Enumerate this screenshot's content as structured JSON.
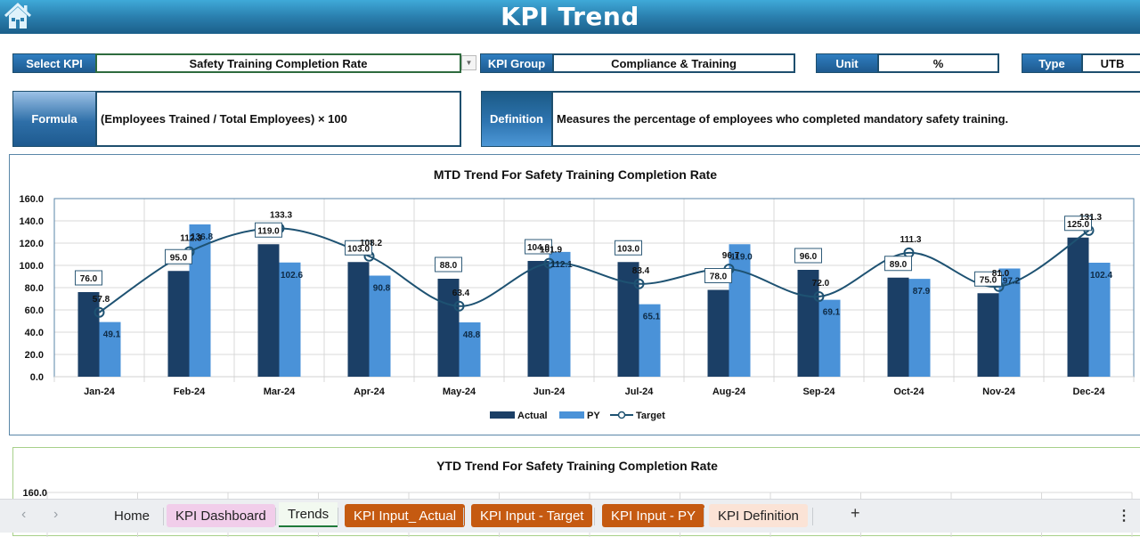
{
  "header": {
    "title": "KPI Trend",
    "home_icon": "home-icon"
  },
  "selectors": {
    "select_kpi_label": "Select KPI",
    "select_kpi_value": "Safety Training Completion Rate",
    "kpi_group_label": "KPI Group",
    "kpi_group_value": "Compliance & Training",
    "unit_label": "Unit",
    "unit_value": "%",
    "type_label": "Type",
    "type_value": "UTB"
  },
  "info": {
    "formula_label": "Formula",
    "formula_value": "(Employees Trained / Total Employees) × 100",
    "definition_label": "Definition",
    "definition_value": "Measures the percentage of employees who completed mandatory safety training."
  },
  "colors": {
    "actual": "#1b3f66",
    "py": "#4a92d8",
    "target": "#1e5272",
    "header": "#2a7fae"
  },
  "chart_data": [
    {
      "type": "bar",
      "title": "MTD Trend For Safety Training Completion Rate",
      "xlabel": "",
      "ylabel": "",
      "ylim": [
        0,
        160
      ],
      "yticks": [
        "0.0",
        "20.0",
        "40.0",
        "60.0",
        "80.0",
        "100.0",
        "120.0",
        "140.0",
        "160.0"
      ],
      "grid": true,
      "legend": "bottom",
      "categories": [
        "Jan-24",
        "Feb-24",
        "Mar-24",
        "Apr-24",
        "May-24",
        "Jun-24",
        "Jul-24",
        "Aug-24",
        "Sep-24",
        "Oct-24",
        "Nov-24",
        "Dec-24"
      ],
      "series": [
        {
          "name": "Actual",
          "kind": "bar",
          "values": [
            76.0,
            95.0,
            119.0,
            103.0,
            88.0,
            104.0,
            103.0,
            78.0,
            96.0,
            89.0,
            75.0,
            125.0
          ]
        },
        {
          "name": "PY",
          "kind": "bar",
          "values": [
            49.1,
            136.8,
            102.6,
            90.8,
            48.8,
            112.1,
            65.1,
            119.0,
            69.1,
            87.9,
            97.2,
            102.4
          ]
        },
        {
          "name": "Target",
          "kind": "line",
          "values": [
            57.8,
            112.3,
            133.3,
            108.2,
            63.4,
            101.9,
            83.4,
            96.7,
            72.0,
            111.3,
            81.0,
            131.3
          ]
        }
      ]
    },
    {
      "type": "bar",
      "title": "YTD Trend For Safety Training Completion Rate",
      "ylim_top_visible": "160.0"
    }
  ],
  "tabs": {
    "prev_icon": "‹",
    "next_icon": "›",
    "items": [
      {
        "label": "Home",
        "bg": "transparent",
        "color": "#222"
      },
      {
        "label": "KPI Dashboard",
        "bg": "#f1cdea",
        "color": "#222"
      },
      {
        "label": "Trends",
        "bg": "",
        "color": "#1c1c1c",
        "active": true
      },
      {
        "label": "KPI Input_ Actual",
        "bg": "#c55a11",
        "color": "#ffffff"
      },
      {
        "label": "KPI Input - Target",
        "bg": "#c55a11",
        "color": "#ffffff"
      },
      {
        "label": "KPI Input - PY",
        "bg": "#c55a11",
        "color": "#ffffff"
      },
      {
        "label": "KPI Definition",
        "bg": "#fbe3d6",
        "color": "#222"
      }
    ],
    "add_icon": "+",
    "more_icon": "⋮"
  }
}
